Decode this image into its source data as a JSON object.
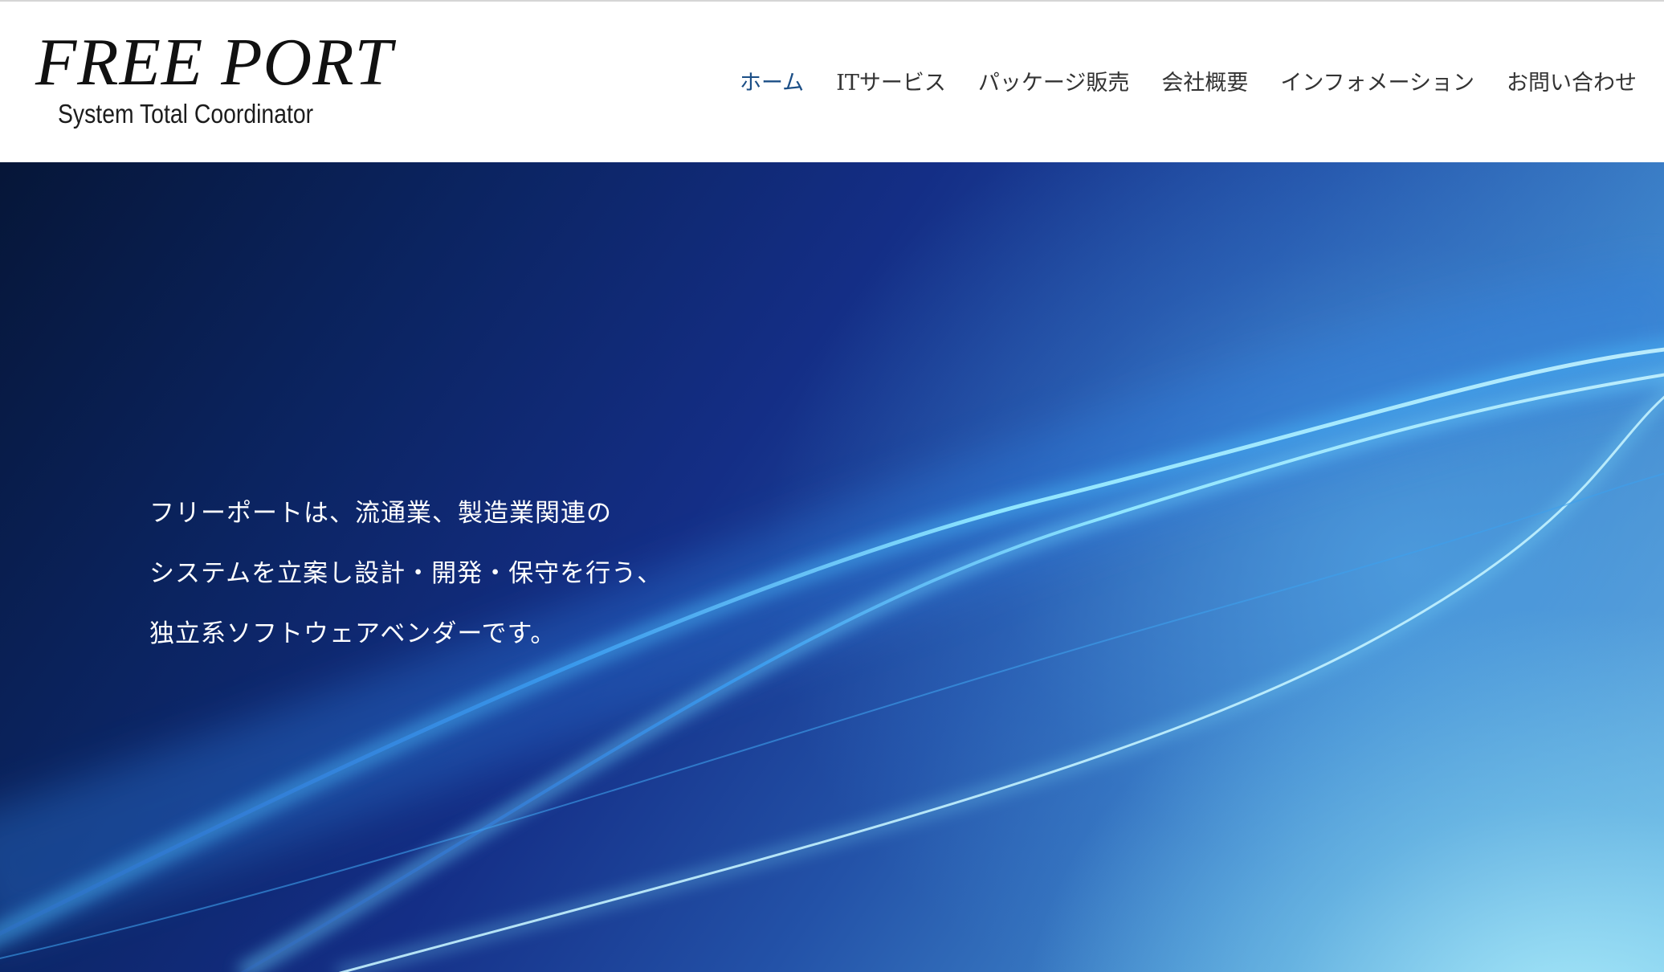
{
  "header": {
    "logo": {
      "title": "FREE PORT",
      "subtitle": "System Total Coordinator"
    },
    "nav": [
      {
        "label": "ホーム",
        "active": true
      },
      {
        "label": "ITサービス",
        "active": false
      },
      {
        "label": "パッケージ販売",
        "active": false
      },
      {
        "label": "会社概要",
        "active": false
      },
      {
        "label": "インフォメーション",
        "active": false
      },
      {
        "label": "お問い合わせ",
        "active": false
      }
    ]
  },
  "hero": {
    "lines": [
      "フリーポートは、流通業、製造業関連の",
      "システムを立案し設計・開発・保守を行う、",
      "独立系ソフトウェアベンダーです。"
    ]
  },
  "colors": {
    "nav_active": "#1b4e86",
    "nav_text": "#333333",
    "hero_dark": "#061638",
    "hero_light": "#7ec7ea"
  }
}
